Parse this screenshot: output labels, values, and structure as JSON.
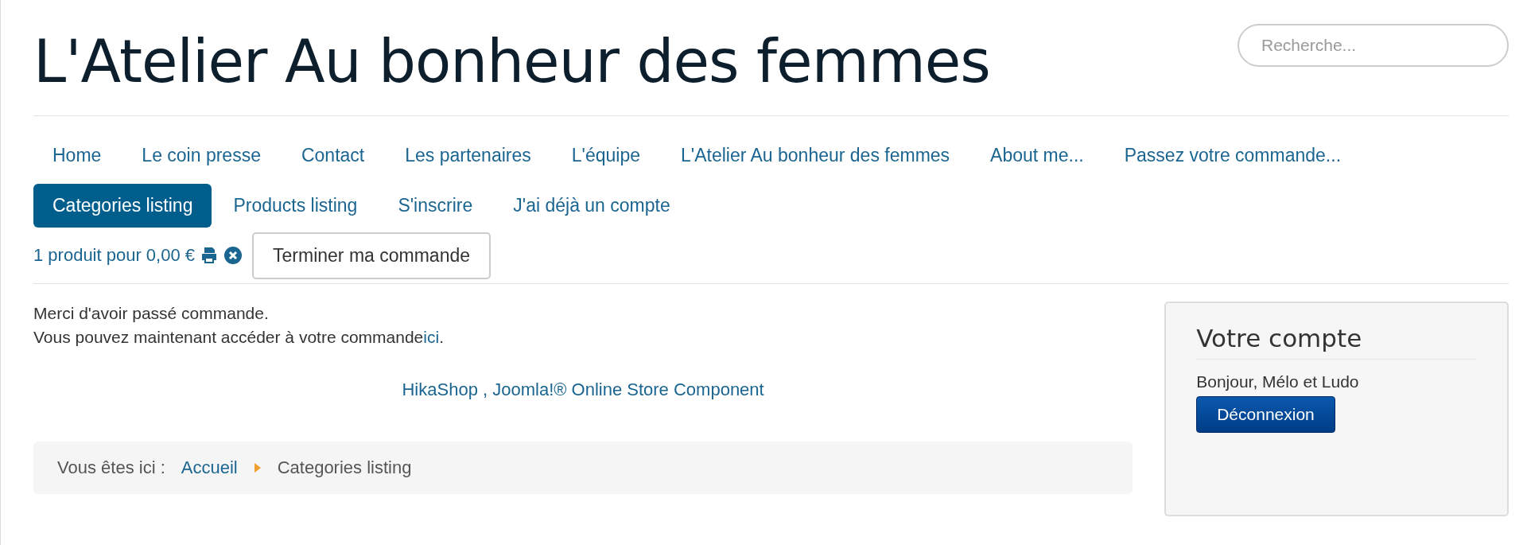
{
  "site_title": "L'Atelier Au bonheur des femmes",
  "search": {
    "placeholder": "Recherche..."
  },
  "menu": [
    {
      "label": "Home",
      "selected": false
    },
    {
      "label": "Le coin presse",
      "selected": false
    },
    {
      "label": "Contact",
      "selected": false
    },
    {
      "label": "Les partenaires",
      "selected": false
    },
    {
      "label": "L'équipe",
      "selected": false
    },
    {
      "label": "L'Atelier Au bonheur des femmes",
      "selected": false
    },
    {
      "label": "About me...",
      "selected": false
    },
    {
      "label": "Passez votre commande...",
      "selected": false
    },
    {
      "label": "Categories listing",
      "selected": true
    },
    {
      "label": "Products listing",
      "selected": false
    },
    {
      "label": "S'inscrire",
      "selected": false
    },
    {
      "label": "J'ai déjà un compte",
      "selected": false
    }
  ],
  "cart": {
    "summary": "1 produit pour 0,00 €",
    "checkout_button": "Terminer ma commande"
  },
  "message": {
    "line_1": "Merci d'avoir passé commande.",
    "line_2": "Vous pouvez maintenant accéder à votre commande",
    "link": "ici",
    "line_end": "."
  },
  "powered_by": "HikaShop , Joomla!® Online Store Component",
  "breadcrumb": {
    "label": "Vous êtes ici :",
    "items": [
      "Accueil",
      "Categories listing"
    ]
  },
  "account": {
    "title": "Votre compte",
    "greeting": "Bonjour, Mélo et Ludo",
    "logout_button": "Déconnexion"
  }
}
